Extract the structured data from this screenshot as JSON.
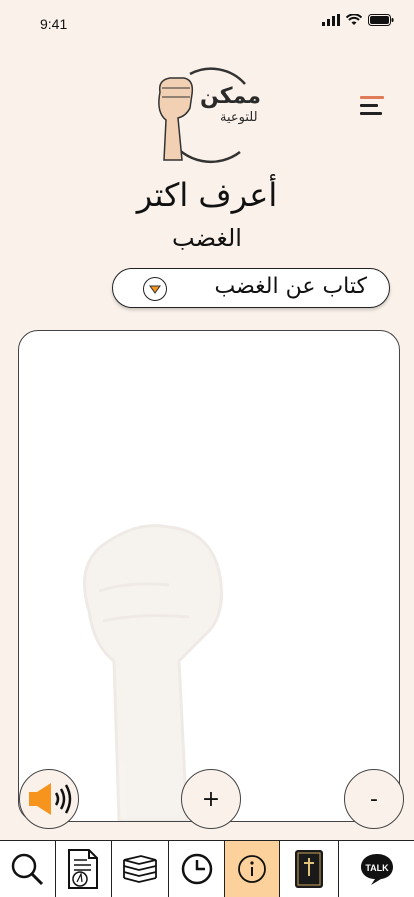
{
  "status": {
    "time": "9:41"
  },
  "logo": {
    "line1": "ممكن",
    "line2": "للتوعية"
  },
  "header": {
    "title": "أعرف اكتر",
    "subtitle": "الغضب"
  },
  "dropdown": {
    "selected": "كتاب عن الغضب"
  },
  "controls": {
    "plus": "+",
    "minus": "-"
  },
  "bottom_nav": [
    {
      "icon": "search-icon"
    },
    {
      "icon": "document-icon"
    },
    {
      "icon": "books-icon"
    },
    {
      "icon": "clock-icon"
    },
    {
      "icon": "info-icon",
      "active": true
    },
    {
      "icon": "holy-book-icon"
    },
    {
      "icon": "talk-icon",
      "label": "TALK"
    }
  ],
  "colors": {
    "accent": "#f7941d",
    "active_tab": "#fcd19c",
    "background": "#faf2ea"
  }
}
